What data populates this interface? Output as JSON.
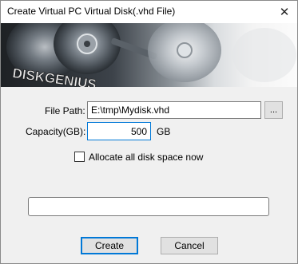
{
  "window": {
    "title": "Create Virtual PC Virtual Disk(.vhd File)",
    "close_glyph": "✕"
  },
  "banner": {
    "logo_text": "DISKGENIUS"
  },
  "form": {
    "file_path_label": "File Path:",
    "file_path_value": "E:\\tmp\\Mydisk.vhd",
    "browse_label": "...",
    "capacity_label": "Capacity(GB):",
    "capacity_value": "500",
    "capacity_unit": "GB",
    "allocate_label": "Allocate all disk space now",
    "allocate_checked": false
  },
  "progress": {
    "value": 0
  },
  "buttons": {
    "create_label": "Create",
    "cancel_label": "Cancel"
  },
  "colors": {
    "accent": "#0078d7",
    "dialog_bg": "#f0f0f0"
  }
}
